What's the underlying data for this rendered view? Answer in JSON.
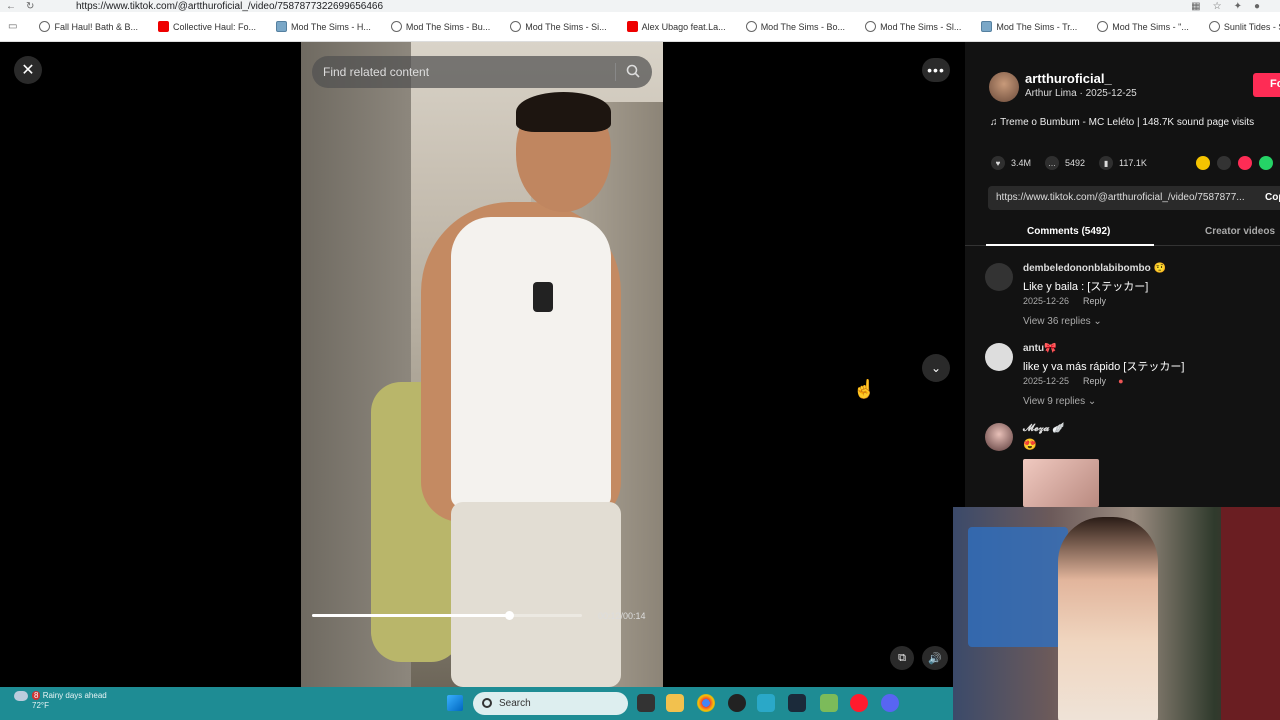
{
  "browser": {
    "url": "https://www.tiktok.com/@artthuroficial_/video/7587877322699656466",
    "bookmarks": [
      "Fall Haul! Bath & B...",
      "Collective Haul: Fo...",
      "Mod The Sims - H...",
      "Mod The Sims - Bu...",
      "Mod The Sims - Si...",
      "Alex Ubago feat.La...",
      "Mod The Sims - Bo...",
      "Mod The Sims - Sl...",
      "Mod The Sims - Tr...",
      "Mod The Sims - \"...",
      "Sunlit Tides - Store..."
    ]
  },
  "player": {
    "search_placeholder": "Find related content",
    "time": "00:12/00:14",
    "progress": 0.73
  },
  "creator": {
    "username": "artthuroficial_",
    "subline": "Arthur Lima · 2025-12-25",
    "follow_label": "Fo",
    "music": "Treme o Bumbum - MC Leléto | 148.7K sound page visits"
  },
  "stats": {
    "likes": "3.4M",
    "comments": "5492",
    "saves": "117.1K"
  },
  "link": {
    "url": "https://www.tiktok.com/@artthuroficial_/video/7587877...",
    "copy_label": "Cop"
  },
  "tabs": {
    "comments": "Comments (5492)",
    "creator": "Creator videos"
  },
  "comments": [
    {
      "name": "dembeledononblabibombo 🤨",
      "text": "Like y baila : [ステッカー]",
      "date": "2025-12-26",
      "reply": "Reply",
      "replies": "View 36 replies ⌄"
    },
    {
      "name": "antu🎀",
      "text": "like y va más rápido [ステッカー]",
      "date": "2025-12-25",
      "reply": "Reply",
      "replies": "View 9 replies ⌄"
    },
    {
      "name": "𝓜𝓮𝔃𝓪 🪽",
      "text": "😍"
    }
  ],
  "taskbar": {
    "weather_badge": "8",
    "weather_text": "Rainy days ahead",
    "temperature": "72°F",
    "search_label": "Search"
  }
}
